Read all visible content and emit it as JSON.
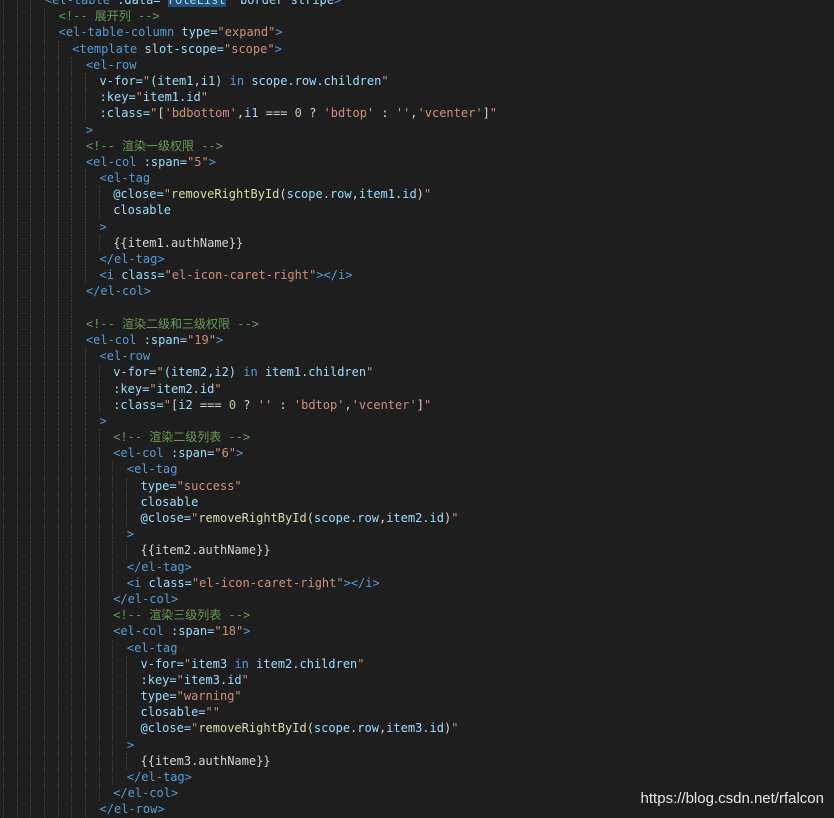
{
  "editor": {
    "theme": {
      "background": "#1e1e1e",
      "guide": "#404040"
    },
    "lines": [
      {
        "indent": 3,
        "tokens": [
          [
            "tag",
            "<el-table"
          ],
          [
            "text",
            " "
          ],
          [
            "attr",
            ":data="
          ],
          [
            "str",
            "\""
          ],
          [
            "sel",
            "roleList"
          ],
          [
            "str",
            "\""
          ],
          [
            "text",
            " "
          ],
          [
            "attr",
            "border"
          ],
          [
            "text",
            " "
          ],
          [
            "attr",
            "stripe"
          ],
          [
            "tag",
            ">"
          ]
        ]
      },
      {
        "indent": 4,
        "tokens": [
          [
            "comment",
            "<!-- 展开列 -->"
          ]
        ]
      },
      {
        "indent": 4,
        "tokens": [
          [
            "tag",
            "<el-table-column"
          ],
          [
            "text",
            " "
          ],
          [
            "attr",
            "type="
          ],
          [
            "str",
            "\"expand\""
          ],
          [
            "tag",
            ">"
          ]
        ]
      },
      {
        "indent": 5,
        "tokens": [
          [
            "tag",
            "<template"
          ],
          [
            "text",
            " "
          ],
          [
            "attr",
            "slot-scope="
          ],
          [
            "str",
            "\"scope\""
          ],
          [
            "tag",
            ">"
          ]
        ]
      },
      {
        "indent": 6,
        "tokens": [
          [
            "tag",
            "<el-row"
          ]
        ]
      },
      {
        "indent": 7,
        "tokens": [
          [
            "attr",
            "v-for="
          ],
          [
            "str",
            "\""
          ],
          [
            "var",
            "(item1,i1)"
          ],
          [
            "text",
            " "
          ],
          [
            "kw",
            "in"
          ],
          [
            "text",
            " "
          ],
          [
            "var",
            "scope.row.children"
          ],
          [
            "str",
            "\""
          ]
        ]
      },
      {
        "indent": 7,
        "tokens": [
          [
            "attr",
            ":key="
          ],
          [
            "str",
            "\""
          ],
          [
            "var",
            "item1.id"
          ],
          [
            "str",
            "\""
          ]
        ]
      },
      {
        "indent": 7,
        "tokens": [
          [
            "attr",
            ":class="
          ],
          [
            "str",
            "\""
          ],
          [
            "text",
            "["
          ],
          [
            "str",
            "'bdbottom'"
          ],
          [
            "text",
            ","
          ],
          [
            "var",
            "i1"
          ],
          [
            "text",
            " === "
          ],
          [
            "num",
            "0"
          ],
          [
            "text",
            " ? "
          ],
          [
            "str",
            "'bdtop'"
          ],
          [
            "text",
            " : "
          ],
          [
            "str",
            "''"
          ],
          [
            "text",
            ","
          ],
          [
            "str",
            "'vcenter'"
          ],
          [
            "text",
            "]"
          ],
          [
            "str",
            "\""
          ]
        ]
      },
      {
        "indent": 6,
        "tokens": [
          [
            "tag",
            ">"
          ]
        ]
      },
      {
        "indent": 6,
        "tokens": [
          [
            "comment",
            "<!-- 渲染一级权限 -->"
          ]
        ]
      },
      {
        "indent": 6,
        "tokens": [
          [
            "tag",
            "<el-col"
          ],
          [
            "text",
            " "
          ],
          [
            "attr",
            ":span="
          ],
          [
            "str",
            "\"5\""
          ],
          [
            "tag",
            ">"
          ]
        ]
      },
      {
        "indent": 7,
        "tokens": [
          [
            "tag",
            "<el-tag"
          ]
        ]
      },
      {
        "indent": 8,
        "tokens": [
          [
            "attr",
            "@close="
          ],
          [
            "str",
            "\""
          ],
          [
            "fn",
            "removeRightById"
          ],
          [
            "text",
            "("
          ],
          [
            "var",
            "scope.row"
          ],
          [
            "text",
            ","
          ],
          [
            "var",
            "item1.id"
          ],
          [
            "text",
            ")"
          ],
          [
            "str",
            "\""
          ]
        ]
      },
      {
        "indent": 8,
        "tokens": [
          [
            "attr",
            "closable"
          ]
        ]
      },
      {
        "indent": 7,
        "tokens": [
          [
            "tag",
            ">"
          ]
        ]
      },
      {
        "indent": 8,
        "tokens": [
          [
            "text",
            "{{item1.authName}}"
          ]
        ]
      },
      {
        "indent": 7,
        "tokens": [
          [
            "tag",
            "</el-tag>"
          ]
        ]
      },
      {
        "indent": 7,
        "tokens": [
          [
            "tag",
            "<i"
          ],
          [
            "text",
            " "
          ],
          [
            "attr",
            "class="
          ],
          [
            "str",
            "\"el-icon-caret-right\""
          ],
          [
            "tag",
            "></i>"
          ]
        ]
      },
      {
        "indent": 6,
        "tokens": [
          [
            "tag",
            "</el-col>"
          ]
        ]
      },
      {
        "indent": 6,
        "tokens": []
      },
      {
        "indent": 6,
        "tokens": [
          [
            "comment",
            "<!-- 渲染二级和三级权限 -->"
          ]
        ]
      },
      {
        "indent": 6,
        "tokens": [
          [
            "tag",
            "<el-col"
          ],
          [
            "text",
            " "
          ],
          [
            "attr",
            ":span="
          ],
          [
            "str",
            "\"19\""
          ],
          [
            "tag",
            ">"
          ]
        ]
      },
      {
        "indent": 7,
        "tokens": [
          [
            "tag",
            "<el-row"
          ]
        ]
      },
      {
        "indent": 8,
        "tokens": [
          [
            "attr",
            "v-for="
          ],
          [
            "str",
            "\""
          ],
          [
            "var",
            "(item2,i2)"
          ],
          [
            "text",
            " "
          ],
          [
            "kw",
            "in"
          ],
          [
            "text",
            " "
          ],
          [
            "var",
            "item1.children"
          ],
          [
            "str",
            "\""
          ]
        ]
      },
      {
        "indent": 8,
        "tokens": [
          [
            "attr",
            ":key="
          ],
          [
            "str",
            "\""
          ],
          [
            "var",
            "item2.id"
          ],
          [
            "str",
            "\""
          ]
        ]
      },
      {
        "indent": 8,
        "tokens": [
          [
            "attr",
            ":class="
          ],
          [
            "str",
            "\""
          ],
          [
            "text",
            "["
          ],
          [
            "var",
            "i2"
          ],
          [
            "text",
            " === "
          ],
          [
            "num",
            "0"
          ],
          [
            "text",
            " ? "
          ],
          [
            "str",
            "''"
          ],
          [
            "text",
            " : "
          ],
          [
            "str",
            "'bdtop'"
          ],
          [
            "text",
            ","
          ],
          [
            "str",
            "'vcenter'"
          ],
          [
            "text",
            "]"
          ],
          [
            "str",
            "\""
          ]
        ]
      },
      {
        "indent": 7,
        "tokens": [
          [
            "tag",
            ">"
          ]
        ]
      },
      {
        "indent": 8,
        "tokens": [
          [
            "comment",
            "<!-- 渲染二级列表 -->"
          ]
        ]
      },
      {
        "indent": 8,
        "tokens": [
          [
            "tag",
            "<el-col"
          ],
          [
            "text",
            " "
          ],
          [
            "attr",
            ":span="
          ],
          [
            "str",
            "\"6\""
          ],
          [
            "tag",
            ">"
          ]
        ]
      },
      {
        "indent": 9,
        "tokens": [
          [
            "tag",
            "<el-tag"
          ]
        ]
      },
      {
        "indent": 10,
        "tokens": [
          [
            "attr",
            "type="
          ],
          [
            "str",
            "\"success\""
          ]
        ]
      },
      {
        "indent": 10,
        "tokens": [
          [
            "attr",
            "closable"
          ]
        ]
      },
      {
        "indent": 10,
        "tokens": [
          [
            "attr",
            "@close="
          ],
          [
            "str",
            "\""
          ],
          [
            "fn",
            "removeRightById"
          ],
          [
            "text",
            "("
          ],
          [
            "var",
            "scope.row"
          ],
          [
            "text",
            ","
          ],
          [
            "var",
            "item2.id"
          ],
          [
            "text",
            ")"
          ],
          [
            "str",
            "\""
          ]
        ]
      },
      {
        "indent": 9,
        "tokens": [
          [
            "tag",
            ">"
          ]
        ]
      },
      {
        "indent": 10,
        "tokens": [
          [
            "text",
            "{{item2.authName}}"
          ]
        ]
      },
      {
        "indent": 9,
        "tokens": [
          [
            "tag",
            "</el-tag>"
          ]
        ]
      },
      {
        "indent": 9,
        "tokens": [
          [
            "tag",
            "<i"
          ],
          [
            "text",
            " "
          ],
          [
            "attr",
            "class="
          ],
          [
            "str",
            "\"el-icon-caret-right\""
          ],
          [
            "tag",
            "></i>"
          ]
        ]
      },
      {
        "indent": 8,
        "tokens": [
          [
            "tag",
            "</el-col>"
          ]
        ]
      },
      {
        "indent": 8,
        "tokens": [
          [
            "comment",
            "<!-- 渲染三级列表 -->"
          ]
        ]
      },
      {
        "indent": 8,
        "tokens": [
          [
            "tag",
            "<el-col"
          ],
          [
            "text",
            " "
          ],
          [
            "attr",
            ":span="
          ],
          [
            "str",
            "\"18\""
          ],
          [
            "tag",
            ">"
          ]
        ]
      },
      {
        "indent": 9,
        "tokens": [
          [
            "tag",
            "<el-tag"
          ]
        ]
      },
      {
        "indent": 10,
        "tokens": [
          [
            "attr",
            "v-for="
          ],
          [
            "str",
            "\""
          ],
          [
            "var",
            "item3"
          ],
          [
            "text",
            " "
          ],
          [
            "kw",
            "in"
          ],
          [
            "text",
            " "
          ],
          [
            "var",
            "item2.children"
          ],
          [
            "str",
            "\""
          ]
        ]
      },
      {
        "indent": 10,
        "tokens": [
          [
            "attr",
            ":key="
          ],
          [
            "str",
            "\""
          ],
          [
            "var",
            "item3.id"
          ],
          [
            "str",
            "\""
          ]
        ]
      },
      {
        "indent": 10,
        "tokens": [
          [
            "attr",
            "type="
          ],
          [
            "str",
            "\"warning\""
          ]
        ]
      },
      {
        "indent": 10,
        "tokens": [
          [
            "attr",
            "closable="
          ],
          [
            "str",
            "\"\""
          ]
        ]
      },
      {
        "indent": 10,
        "tokens": [
          [
            "attr",
            "@close="
          ],
          [
            "str",
            "\""
          ],
          [
            "fn",
            "removeRightById"
          ],
          [
            "text",
            "("
          ],
          [
            "var",
            "scope.row"
          ],
          [
            "text",
            ","
          ],
          [
            "var",
            "item3.id"
          ],
          [
            "text",
            ")"
          ],
          [
            "str",
            "\""
          ]
        ]
      },
      {
        "indent": 9,
        "tokens": [
          [
            "tag",
            ">"
          ]
        ]
      },
      {
        "indent": 10,
        "tokens": [
          [
            "text",
            "{{item3.authName}}"
          ]
        ]
      },
      {
        "indent": 9,
        "tokens": [
          [
            "tag",
            "</el-tag>"
          ]
        ]
      },
      {
        "indent": 8,
        "tokens": [
          [
            "tag",
            "</el-col>"
          ]
        ]
      },
      {
        "indent": 7,
        "tokens": [
          [
            "tag",
            "</el-row>"
          ]
        ]
      }
    ]
  },
  "watermark": {
    "text": "https://blog.csdn.net/rfalcon"
  }
}
